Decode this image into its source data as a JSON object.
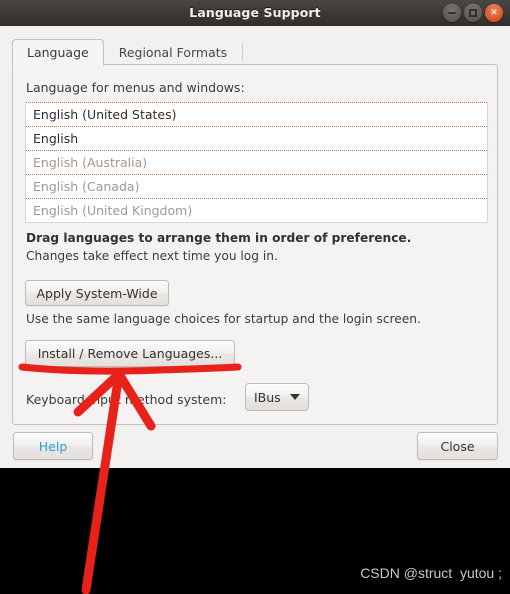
{
  "window": {
    "title": "Language Support",
    "buttons": {
      "minimize": "minimize",
      "maximize": "maximize",
      "close": "×"
    }
  },
  "tabs": [
    {
      "label": "Language",
      "active": true
    },
    {
      "label": "Regional Formats",
      "active": false
    }
  ],
  "language_tab": {
    "menus_label": "Language for menus and windows:",
    "languages": [
      {
        "label": "English (United States)",
        "muted": false
      },
      {
        "label": "English",
        "muted": false
      },
      {
        "label": "English (Australia)",
        "muted": true
      },
      {
        "label": "English (Canada)",
        "muted": true
      },
      {
        "label": "English (United Kingdom)",
        "muted": true
      }
    ],
    "hint_bold": "Drag languages to arrange them in order of preference.",
    "hint_normal": "Changes take effect next time you log in.",
    "apply_button": "Apply System-Wide",
    "apply_note": "Use the same language choices for startup and the login screen.",
    "install_button": "Install / Remove Languages...",
    "keyboard_label": "Keyboard input method system:",
    "keyboard_value": "IBus"
  },
  "footer": {
    "help_button": "Help",
    "close_button": "Close"
  },
  "watermark": "CSDN @struct  yutou ;",
  "colors": {
    "title_bar": "#3c3937",
    "close_button": "#dd5c30",
    "window_bg": "#f2f1f0",
    "list_separator": "#c6714a",
    "help_link": "#2a9fd6",
    "annotation": "#e8211a",
    "black_panel": "#000000"
  }
}
